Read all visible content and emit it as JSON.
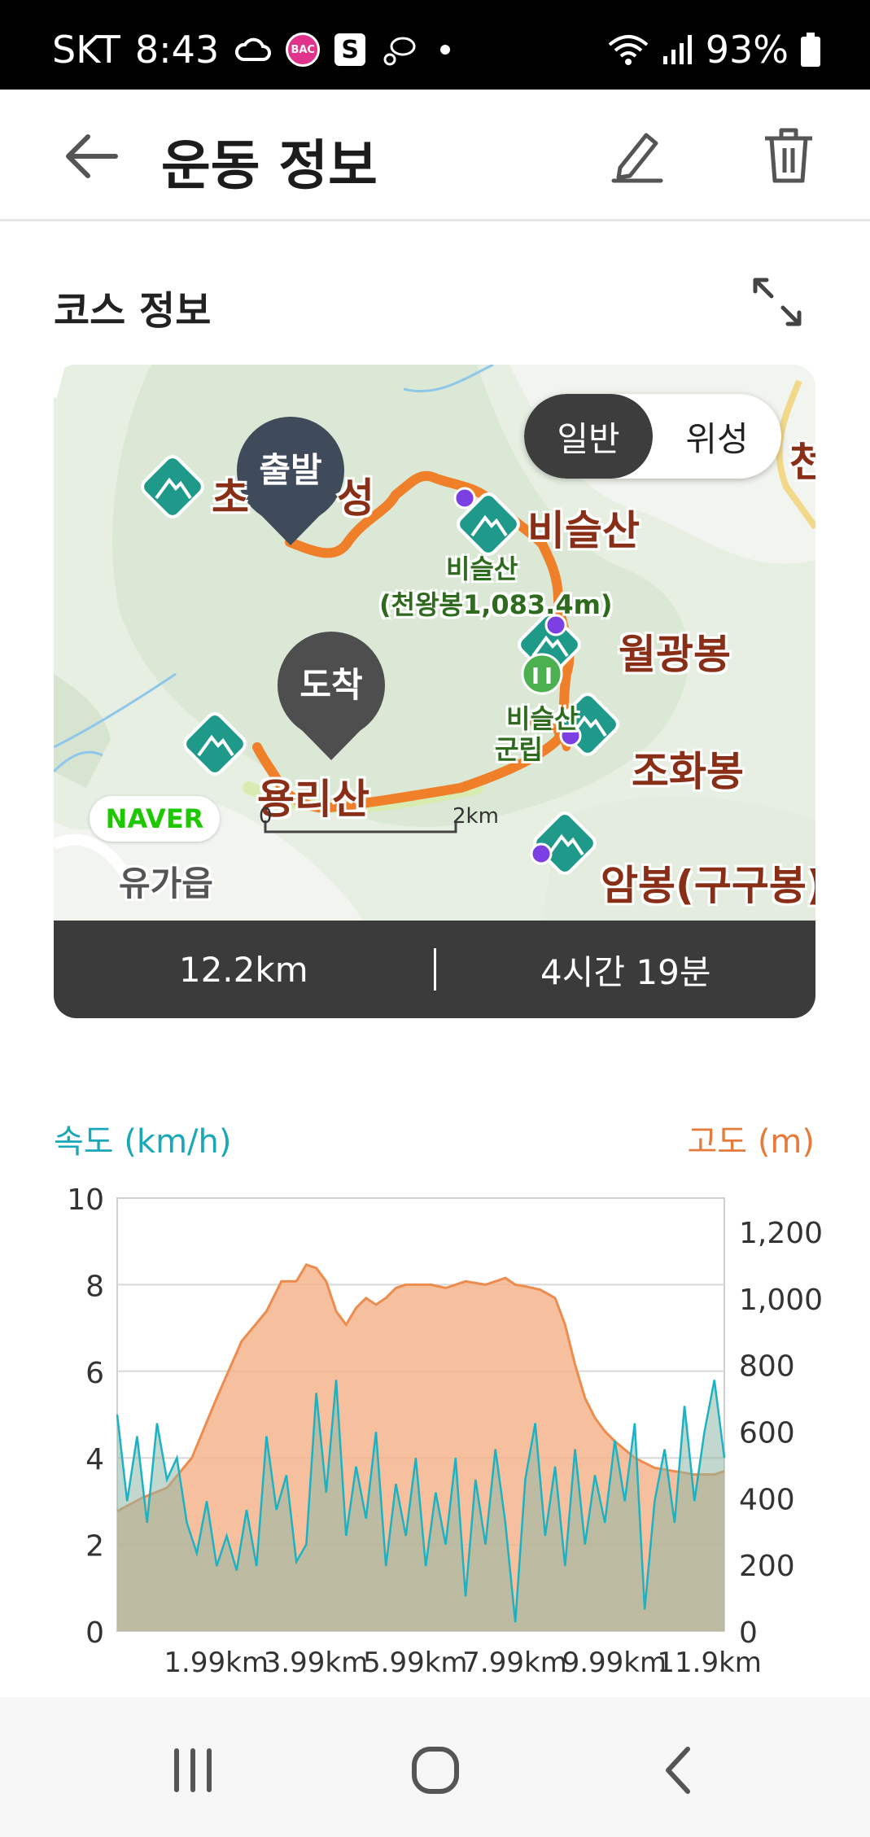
{
  "status_bar": {
    "carrier": "SKT",
    "time": "8:43",
    "battery": "93%",
    "icons": [
      "cloud-icon",
      "bac-icon",
      "s-icon",
      "fitness-icon",
      "wifi-icon",
      "signal-icon",
      "battery-icon"
    ]
  },
  "header": {
    "title": "운동 정보",
    "icons": [
      "back-arrow-icon",
      "edit-icon",
      "trash-icon"
    ]
  },
  "course": {
    "section_title": "코스 정보",
    "map_toggle": {
      "options": [
        "일반",
        "위성"
      ],
      "selected": "일반"
    },
    "pins": {
      "start": "출발",
      "end": "도착"
    },
    "labels": {
      "peak1": "비슬산",
      "peak1_sub1": "비슬산",
      "peak1_sub2": "(천왕봉1,083.4m)",
      "peak2": "월광봉",
      "peak3": "조화봉",
      "peak4": "암봉(구구봉)",
      "peak5": "용리산",
      "partial_left": "초",
      "partial_left2": "성",
      "partial_right": "천",
      "park1": "비슬산",
      "park2": "군립",
      "town": "유가읍",
      "naver": "NAVER",
      "scale_zero": "0",
      "scale_end": "2km"
    },
    "distance": "12.2km",
    "duration": "4시간 19분"
  },
  "chart_labels": {
    "speed_legend": "속도 (km/h)",
    "altitude_legend": "고도 (m)"
  },
  "chart_data": {
    "type": "area",
    "x_tick_labels": [
      "1.99km",
      "3.99km",
      "5.99km",
      "7.99km",
      "9.99km",
      "11.9km"
    ],
    "x_ticks_km": [
      1.99,
      3.99,
      5.99,
      7.99,
      9.99,
      11.9
    ],
    "x_range_km": [
      0,
      12.2
    ],
    "y_left": {
      "label": "속도 (km/h)",
      "ticks": [
        0,
        2,
        4,
        6,
        8,
        10
      ],
      "range": [
        0,
        10
      ]
    },
    "y_right": {
      "label": "고도 (m)",
      "ticks": [
        0,
        200,
        400,
        600,
        800,
        1000,
        1200
      ],
      "range": [
        0,
        1300
      ]
    },
    "grid": true,
    "series": [
      {
        "name": "고도 (m)",
        "color": "#f4b48c",
        "x": [
          0,
          0.5,
          1.0,
          1.5,
          2.0,
          2.5,
          3.0,
          3.3,
          3.6,
          3.8,
          4.0,
          4.2,
          4.4,
          4.6,
          4.8,
          5.0,
          5.2,
          5.4,
          5.6,
          5.8,
          6.0,
          6.3,
          6.6,
          7.0,
          7.4,
          7.8,
          8.0,
          8.2,
          8.5,
          8.8,
          9.0,
          9.2,
          9.4,
          9.6,
          9.8,
          10.0,
          10.4,
          10.8,
          11.2,
          11.6,
          12.0,
          12.2
        ],
        "values": [
          360,
          400,
          430,
          520,
          700,
          870,
          960,
          1050,
          1050,
          1100,
          1090,
          1050,
          960,
          920,
          970,
          1000,
          980,
          1000,
          1030,
          1040,
          1040,
          1040,
          1030,
          1050,
          1040,
          1060,
          1040,
          1035,
          1025,
          1000,
          920,
          800,
          700,
          640,
          600,
          570,
          520,
          490,
          480,
          470,
          470,
          480
        ]
      },
      {
        "name": "속도 (km/h)",
        "color": "#1bb3c4",
        "x": [
          0,
          0.2,
          0.4,
          0.6,
          0.8,
          1.0,
          1.2,
          1.4,
          1.6,
          1.8,
          2.0,
          2.2,
          2.4,
          2.6,
          2.8,
          3.0,
          3.2,
          3.4,
          3.6,
          3.8,
          4.0,
          4.2,
          4.4,
          4.6,
          4.8,
          5.0,
          5.2,
          5.4,
          5.6,
          5.8,
          6.0,
          6.2,
          6.4,
          6.6,
          6.8,
          7.0,
          7.2,
          7.4,
          7.6,
          7.8,
          8.0,
          8.2,
          8.4,
          8.6,
          8.8,
          9.0,
          9.2,
          9.4,
          9.6,
          9.8,
          10.0,
          10.2,
          10.4,
          10.6,
          10.8,
          11.0,
          11.2,
          11.4,
          11.6,
          11.8,
          12.0,
          12.2
        ],
        "values": [
          5.0,
          3.0,
          4.5,
          2.5,
          4.8,
          3.5,
          4.0,
          2.5,
          1.8,
          3.0,
          1.5,
          2.2,
          1.4,
          2.8,
          1.5,
          4.5,
          2.8,
          3.6,
          1.6,
          2.0,
          5.5,
          3.2,
          5.8,
          2.2,
          3.8,
          2.6,
          4.6,
          1.5,
          3.4,
          2.2,
          4.0,
          1.5,
          3.2,
          2.0,
          4.0,
          0.8,
          3.5,
          2.0,
          4.2,
          2.5,
          0.2,
          3.5,
          4.8,
          2.2,
          3.8,
          1.5,
          4.2,
          2.0,
          3.6,
          2.5,
          4.4,
          3.0,
          4.8,
          0.5,
          3.0,
          4.2,
          2.5,
          5.2,
          3.0,
          4.6,
          5.8,
          4.0
        ]
      }
    ]
  },
  "nav_bar": {
    "icons": [
      "recent-apps-icon",
      "home-icon",
      "back-icon"
    ]
  }
}
